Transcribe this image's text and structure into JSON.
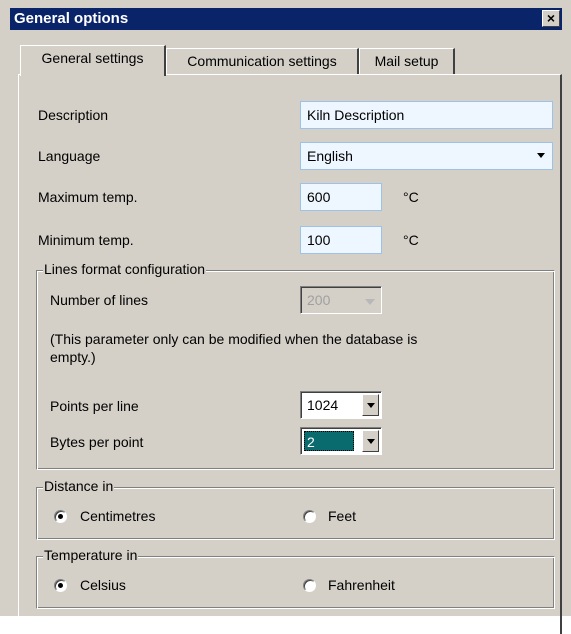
{
  "window": {
    "title": "General options",
    "close_glyph": "×"
  },
  "tabs": [
    {
      "label": "General settings",
      "active": true
    },
    {
      "label": "Communication settings",
      "active": false
    },
    {
      "label": "Mail setup",
      "active": false
    }
  ],
  "form": {
    "description": {
      "label": "Description",
      "value": "Kiln Description"
    },
    "language": {
      "label": "Language",
      "value": "English"
    },
    "max_temp": {
      "label": "Maximum temp.",
      "value": "600",
      "unit": "°C"
    },
    "min_temp": {
      "label": "Minimum temp.",
      "value": "100",
      "unit": "°C"
    }
  },
  "lines_group": {
    "legend": "Lines format configuration",
    "number_of_lines": {
      "label": "Number of lines",
      "value": "200"
    },
    "note_line1": "(This parameter only can be modified when the database is",
    "note_line2": "empty.)",
    "points_per_line": {
      "label": "Points per line",
      "value": "1024"
    },
    "bytes_per_point": {
      "label": "Bytes per point",
      "value": "2"
    }
  },
  "distance_group": {
    "legend": "Distance in",
    "options": [
      {
        "label": "Centimetres",
        "selected": true
      },
      {
        "label": "Feet",
        "selected": false
      }
    ]
  },
  "temperature_group": {
    "legend": "Temperature in",
    "options": [
      {
        "label": "Celsius",
        "selected": true
      },
      {
        "label": "Fahrenheit",
        "selected": false
      }
    ]
  },
  "colors": {
    "titlebar": "#0a246a",
    "face": "#d4d0c8",
    "focus_field": "#eef7ff",
    "selected_item": "#0a6b6e"
  }
}
